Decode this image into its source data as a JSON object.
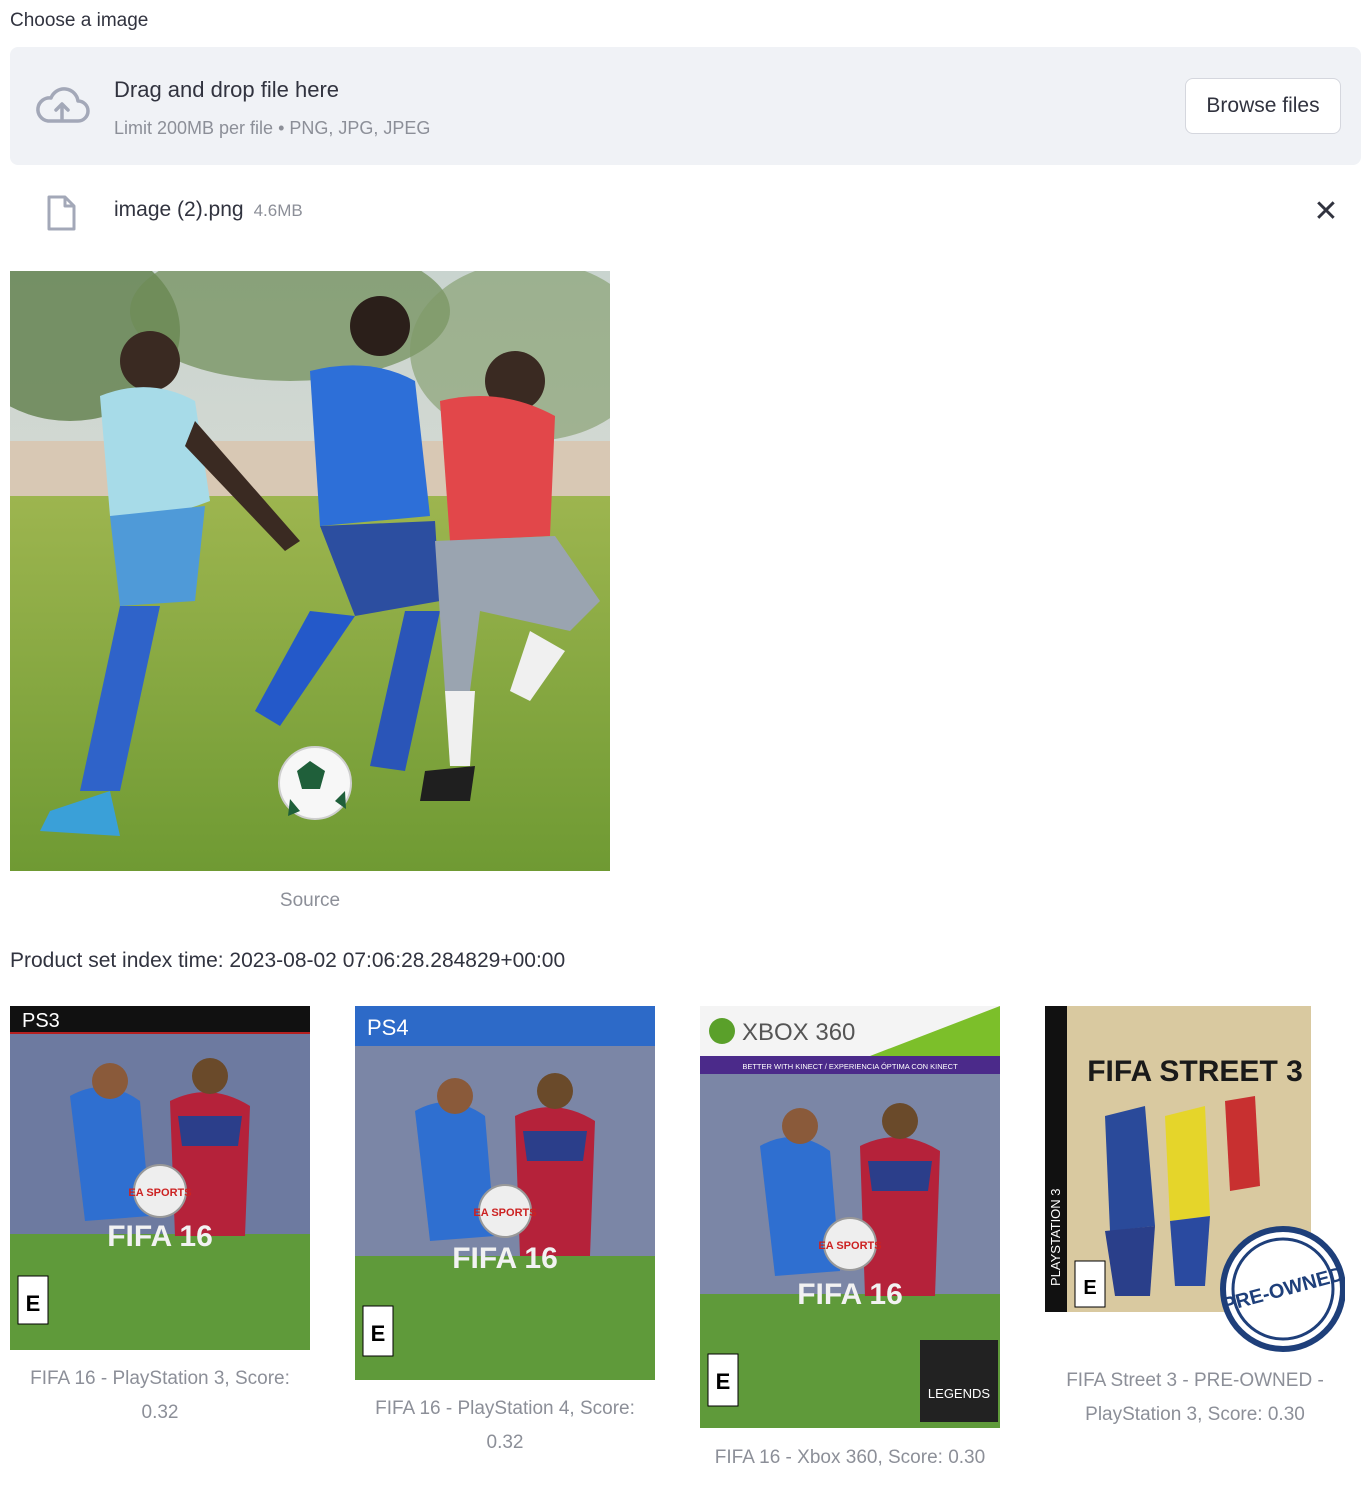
{
  "uploader": {
    "label": "Choose a image",
    "drop_title": "Drag and drop file here",
    "drop_subtitle": "Limit 200MB per file • PNG, JPG, JPEG",
    "browse_label": "Browse files",
    "cloud_icon": "cloud-upload-icon"
  },
  "file": {
    "name": "image (2).png",
    "size": "4.6MB",
    "icon": "file-icon",
    "remove_icon": "close-icon"
  },
  "source": {
    "caption": "Source"
  },
  "results": {
    "index_time": "Product set index time: 2023-08-02 07:06:28.284829+00:00",
    "items": [
      {
        "caption": "FIFA 16 - PlayStation 3, Score: 0.32",
        "cover": {
          "platform": "PS3",
          "title": "FIFA 16",
          "badge": "EA SPORTS",
          "rating": "E"
        }
      },
      {
        "caption": "FIFA 16 - PlayStation 4, Score: 0.32",
        "cover": {
          "platform": "PS4",
          "title": "FIFA 16",
          "badge": "EA SPORTS",
          "rating": "E"
        }
      },
      {
        "caption": "FIFA 16 - Xbox 360, Score: 0.30",
        "cover": {
          "platform": "XBOX 360",
          "kinect_banner": "BETTER WITH KINECT / EXPERIENCIA ÓPTIMA CON KINECT",
          "title": "FIFA 16",
          "badge": "EA SPORTS",
          "rating": "E",
          "extra": "LEGENDS"
        }
      },
      {
        "caption": "FIFA Street 3 - PRE-OWNED - PlayStation 3, Score: 0.30",
        "cover": {
          "platform": "PLAYSTATION 3",
          "title": "FIFA STREET 3",
          "stamp": "PRE-OWNED",
          "rating": "E"
        }
      }
    ]
  },
  "colors": {
    "dropzone_bg": "#f0f2f6",
    "text": "#31333f",
    "muted": "#8c8f98",
    "grass": "#7aa23a"
  }
}
